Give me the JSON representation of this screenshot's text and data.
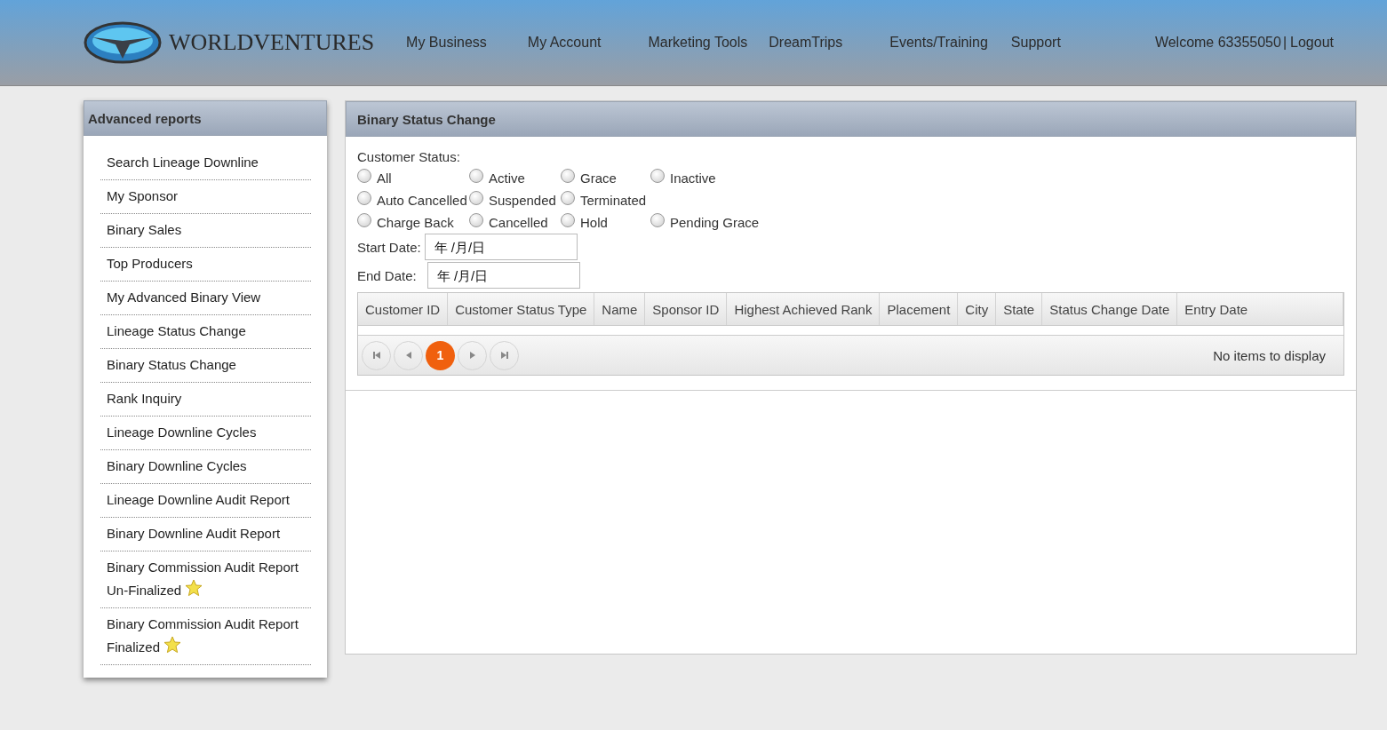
{
  "header": {
    "logo_text": "WORLDVENTURES",
    "nav": [
      "My Business",
      "My Account",
      "Marketing Tools",
      "DreamTrips",
      "Events/Training",
      "Support"
    ],
    "welcome": "Welcome 63355050",
    "separator": "|",
    "logout": "Logout"
  },
  "sidebar": {
    "title": "Advanced reports",
    "items": [
      {
        "label": "Search Lineage Downline",
        "starred": false
      },
      {
        "label": "My Sponsor",
        "starred": false
      },
      {
        "label": "Binary Sales",
        "starred": false
      },
      {
        "label": "Top Producers",
        "starred": false
      },
      {
        "label": "My Advanced Binary View",
        "starred": false
      },
      {
        "label": "Lineage Status Change",
        "starred": false
      },
      {
        "label": "Binary Status Change",
        "starred": false
      },
      {
        "label": "Rank Inquiry",
        "starred": false
      },
      {
        "label": "Lineage Downline Cycles",
        "starred": false
      },
      {
        "label": "Binary Downline Cycles",
        "starred": false
      },
      {
        "label": "Lineage Downline Audit Report",
        "starred": false
      },
      {
        "label": "Binary Downline Audit Report",
        "starred": false
      },
      {
        "label": "Binary Commission Audit Report Un-Finalized",
        "starred": true
      },
      {
        "label": "Binary Commission Audit Report Finalized",
        "starred": true
      }
    ]
  },
  "panel": {
    "title": "Binary Status Change",
    "status_label": "Customer Status:",
    "statuses": [
      {
        "label": "All",
        "selected": false
      },
      {
        "label": "Active",
        "selected": false
      },
      {
        "label": "Grace",
        "selected": false
      },
      {
        "label": "Inactive",
        "selected": false
      },
      {
        "label": "Auto Cancelled",
        "selected": false
      },
      {
        "label": "Suspended",
        "selected": false
      },
      {
        "label": "Terminated",
        "selected": false
      },
      {
        "label": "Charge Back",
        "selected": false
      },
      {
        "label": "Cancelled",
        "selected": false
      },
      {
        "label": "Hold",
        "selected": false
      },
      {
        "label": "Pending Grace",
        "selected": false
      }
    ],
    "start_date": {
      "label": "Start Date:",
      "placeholder": "年 /月/日"
    },
    "end_date": {
      "label": "End Date:",
      "placeholder": "年 /月/日"
    },
    "table": {
      "columns": [
        "Customer ID",
        "Customer Status Type",
        "Name",
        "Sponsor ID",
        "Highest Achieved Rank",
        "Placement",
        "City",
        "State",
        "Status Change Date",
        "Entry Date"
      ]
    },
    "pager": {
      "pages": [
        {
          "label": "1",
          "selected": true
        }
      ],
      "status": "No items to display"
    }
  }
}
